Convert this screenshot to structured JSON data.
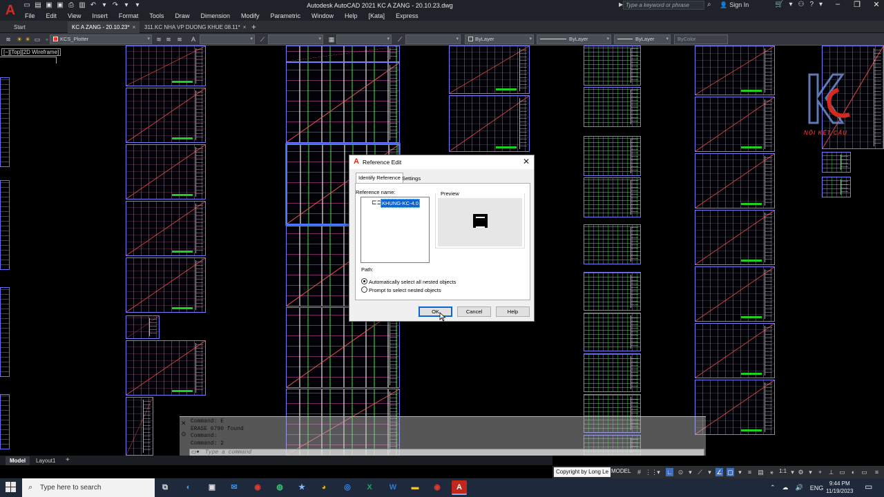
{
  "app": {
    "logo": "A",
    "title": "Autodesk AutoCAD 2021   KC A ZANG - 20.10.23.dwg",
    "search_placeholder": "Type a keyword or phrase",
    "signin": "Sign In"
  },
  "menu": [
    "File",
    "Edit",
    "View",
    "Insert",
    "Format",
    "Tools",
    "Draw",
    "Dimension",
    "Modify",
    "Parametric",
    "Window",
    "Help",
    "[Kata]",
    "Express"
  ],
  "tabs": {
    "start": "Start",
    "doc1": "KC A ZANG - 20.10.23*",
    "doc2": "311.KC NHA VP DUONG KHUE 08.11*",
    "close": "×",
    "add": "+"
  },
  "toolbar": {
    "layer_name": "KCS_Plotter",
    "bylayer1": "ByLayer",
    "bylayer2": "ByLayer",
    "bylayer3": "ByLayer",
    "bycolor": "ByColor"
  },
  "viewport_label": "[−][Top][2D Wireframe]",
  "watermark_text": "NỘI KẾT CẤU",
  "dialog": {
    "title": "Reference Edit",
    "tab_identify": "Identify Reference",
    "tab_settings": "Settings",
    "refname_label": "Reference name:",
    "ref_item": "KHUNG-KC-4.0",
    "preview_label": "Preview",
    "path_label": "Path:",
    "radio_auto": "Automatically select all nested objects",
    "radio_prompt": "Prompt to select nested objects",
    "ok": "OK",
    "cancel": "Cancel",
    "help": "Help",
    "close": "✕"
  },
  "command": {
    "lines": [
      "Command: E",
      "ERASE 6790 found",
      "Command:",
      "Command: 2"
    ],
    "placeholder": "Type a command"
  },
  "layout_tabs": {
    "model": "Model",
    "layout1": "Layout1",
    "add": "+"
  },
  "status": {
    "copyright": "Copyright by Long Le",
    "model": "MODEL",
    "scale": "1:1"
  },
  "taskbar": {
    "search_placeholder": "Type here to search",
    "language": "ENG",
    "time": "9:44 PM",
    "date": "11/19/2023"
  },
  "colors": {
    "sheet_border": "#7d7dff",
    "accent_red": "#d52b1e",
    "selection_blue": "#0a64d8"
  }
}
